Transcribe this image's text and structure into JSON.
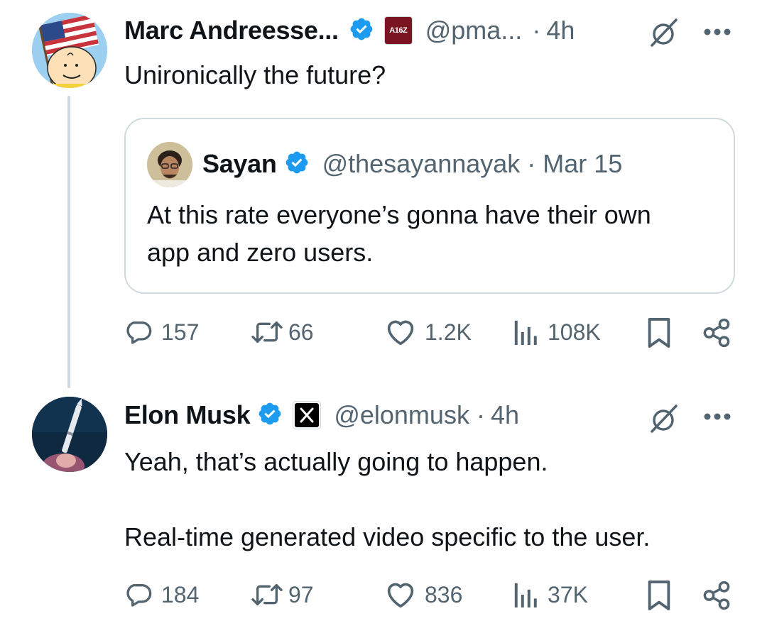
{
  "tweet1": {
    "author_name": "Marc Andreesse...",
    "affiliate_badge": "A16Z",
    "handle": "@pma...",
    "separator": "·",
    "time": "4h",
    "text": "Unironically the future?",
    "quote": {
      "author_name": "Sayan",
      "handle": "@thesayannayak",
      "separator": "·",
      "date": "Mar 15",
      "text_line1": "At this rate everyone’s gonna have their own",
      "text_line2": "app and zero users."
    },
    "actions": {
      "replies": "157",
      "reposts": "66",
      "likes": "1.2K",
      "views": "108K"
    }
  },
  "tweet2": {
    "author_name": "Elon Musk",
    "handle": "@elonmusk",
    "separator": "·",
    "time": "4h",
    "text_line1": "Yeah, that’s actually going to happen.",
    "text_line2": "Real-time generated video specific to the user.",
    "actions": {
      "replies": "184",
      "reposts": "97",
      "likes": "836",
      "views": "37K"
    }
  },
  "colors": {
    "verified_blue": "#1d9bf0",
    "muted_text": "#536471",
    "border": "#cfd9de",
    "a16z_badge": "#7a1420"
  }
}
